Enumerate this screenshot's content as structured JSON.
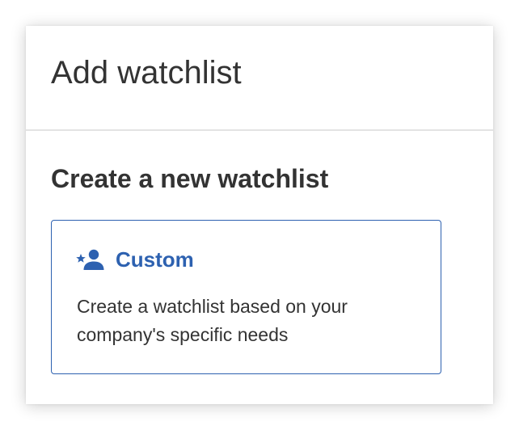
{
  "dialog": {
    "title": "Add watchlist"
  },
  "section": {
    "title": "Create a new watchlist"
  },
  "options": [
    {
      "icon": "starred-person-icon",
      "title": "Custom",
      "description": "Create a watchlist based on your company's specific needs"
    }
  ],
  "colors": {
    "accent": "#2d61b0",
    "text": "#333333",
    "divider": "#e3e3e3"
  }
}
